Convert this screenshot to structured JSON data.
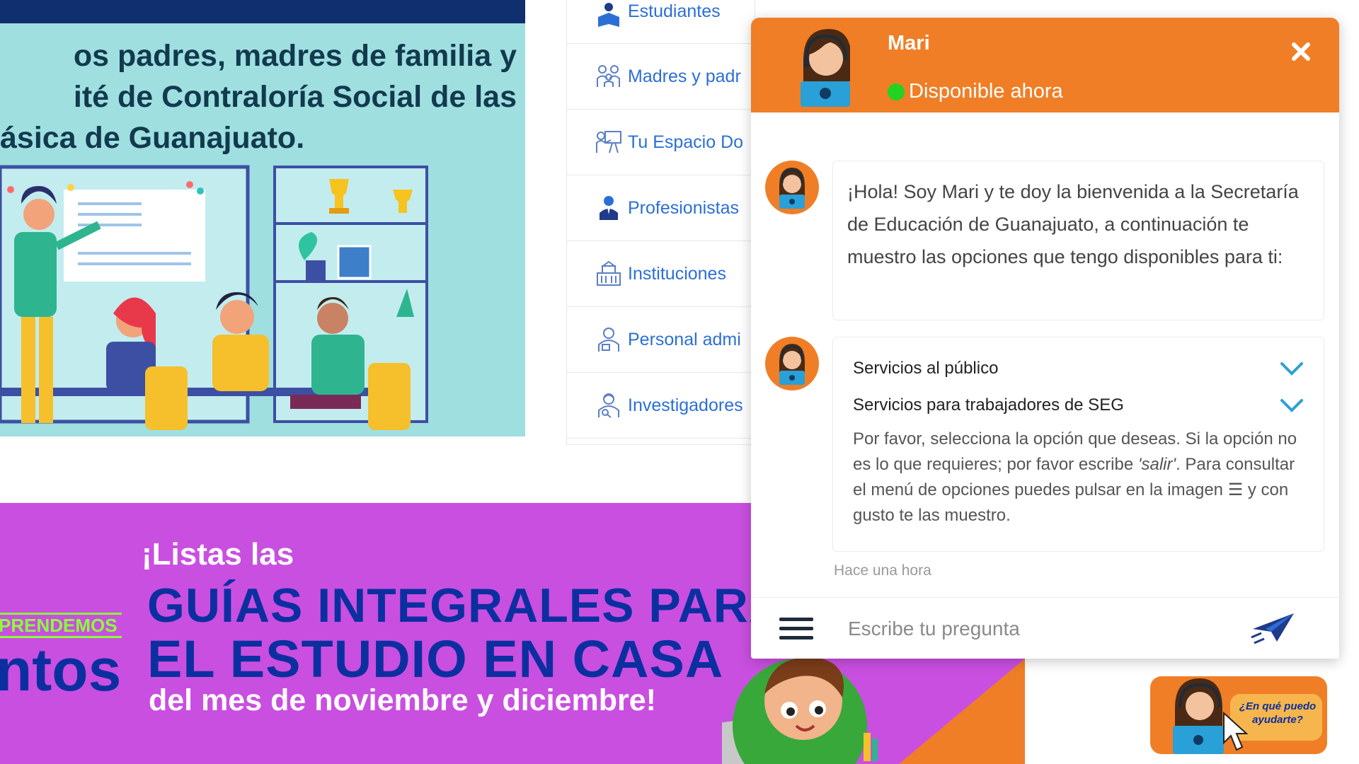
{
  "hero": {
    "lines": [
      "os padres, madres de familia y",
      "ité de Contraloría Social de las",
      "ásica de Guanajuato."
    ]
  },
  "nav": {
    "items": [
      {
        "label": "Estudiantes",
        "icon": "student-reading-icon"
      },
      {
        "label": "Madres y padr",
        "icon": "family-icon"
      },
      {
        "label": "Tu Espacio Do",
        "icon": "teacher-board-icon"
      },
      {
        "label": "Profesionistas",
        "icon": "professional-person-icon"
      },
      {
        "label": "Instituciones",
        "icon": "institution-building-icon"
      },
      {
        "label": "Personal admi",
        "icon": "admin-staff-icon"
      },
      {
        "label": "Investigadores",
        "icon": "researcher-icon"
      }
    ]
  },
  "promo": {
    "small_title": "¡Listas las",
    "big_line1": "GUÍAS INTEGRALES PARA",
    "big_line2": "EL ESTUDIO EN CASA",
    "subtitle": "del mes de noviembre y diciembre!",
    "aprendemos": "PRENDEMOS",
    "ntos": "ntos"
  },
  "chat": {
    "agent_name": "Mari",
    "status": "Disponible ahora",
    "welcome_message": "¡Hola! Soy Mari y te doy la bienvenida a la Secretaría de Educación de Guanajuato, a continuación te muestro las opciones que tengo disponibles para ti:",
    "options": [
      {
        "label": "Servicios al público"
      },
      {
        "label": "Servicios para trabajadores de SEG"
      }
    ],
    "instruction_part1": "Por favor, selecciona la opción que deseas. Si la opción no es lo que requieres; por favor escribe ",
    "instruction_keyword": "'salir'",
    "instruction_part2": ". Para consultar el menú de opciones puedes pulsar en la imagen ☰ y con gusto te las muestro.",
    "timestamp": "Hace una hora",
    "input_placeholder": "Escribe tu pregunta"
  },
  "help_widget": {
    "text": "¿En qué puedo ayudarte?"
  },
  "colors": {
    "chat_orange": "#f07e26",
    "online_green": "#22d322",
    "nav_blue": "#2b6fd6",
    "promo_purple": "#c94fe0",
    "promo_navy": "#0c2fa0"
  }
}
